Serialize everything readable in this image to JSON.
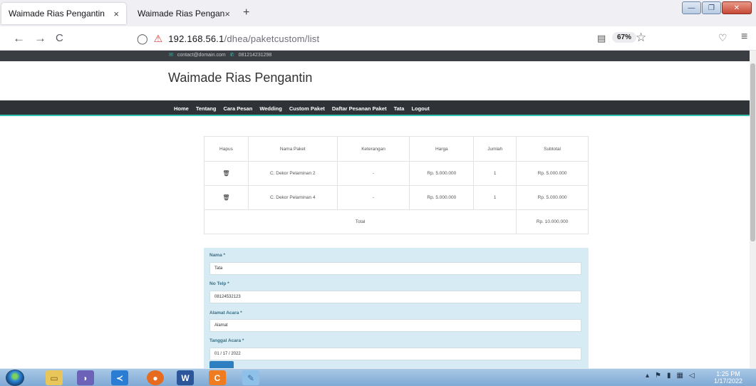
{
  "browser": {
    "tabs": [
      {
        "title": "Waimade Rias Pengantin",
        "close": "×"
      },
      {
        "title": "Waimade Rias Pengantin",
        "close": "×"
      }
    ],
    "new_tab": "+",
    "url_host": "192.168.56.1",
    "url_path": "/dhea/paketcustom/list",
    "zoom": "67%",
    "icons": {
      "back": "←",
      "forward": "→",
      "reload": "C",
      "shield": "◯",
      "lock": "🔒",
      "reader": "▤",
      "star": "☆",
      "pocket": "♡",
      "menu": "≡"
    }
  },
  "site": {
    "contact_email": "contact@domain.com",
    "contact_phone": "081214231298",
    "brand": "Waimade Rias Pengantin",
    "nav": [
      "Home",
      "Tentang",
      "Cara Pesan",
      "Wedding",
      "Custom Paket",
      "Daftar Pesanan Paket",
      "Tata",
      "Logout"
    ],
    "accent_color": "#34c2b3"
  },
  "cart": {
    "headers": [
      "Hapus",
      "Nama Paket",
      "Keterangan",
      "Harga",
      "Jumlah",
      "Subtotal"
    ],
    "rows": [
      {
        "nama": "C. Dekor Pelaminan 2",
        "keterangan": "-",
        "harga": "Rp. 5.000.000",
        "jumlah": "1",
        "subtotal": "Rp. 5.000.000"
      },
      {
        "nama": "C. Dekor Pelaminan 4",
        "keterangan": "-",
        "harga": "Rp. 5.000.000",
        "jumlah": "1",
        "subtotal": "Rp. 5.000.000"
      }
    ],
    "total_label": "Total",
    "total_value": "Rp. 10.000.000"
  },
  "form": {
    "nama_label": "Nama *",
    "nama_value": "Tata",
    "telp_label": "No Telp *",
    "telp_value": "08124532123",
    "alamat_label": "Alamat Acara *",
    "alamat_value": "Alamat",
    "tanggal_label": "Tanggal Acara *",
    "tanggal_value": "01 / 17 / 2022"
  },
  "taskbar": {
    "time": "1:25 PM",
    "date": "1/17/2022"
  }
}
